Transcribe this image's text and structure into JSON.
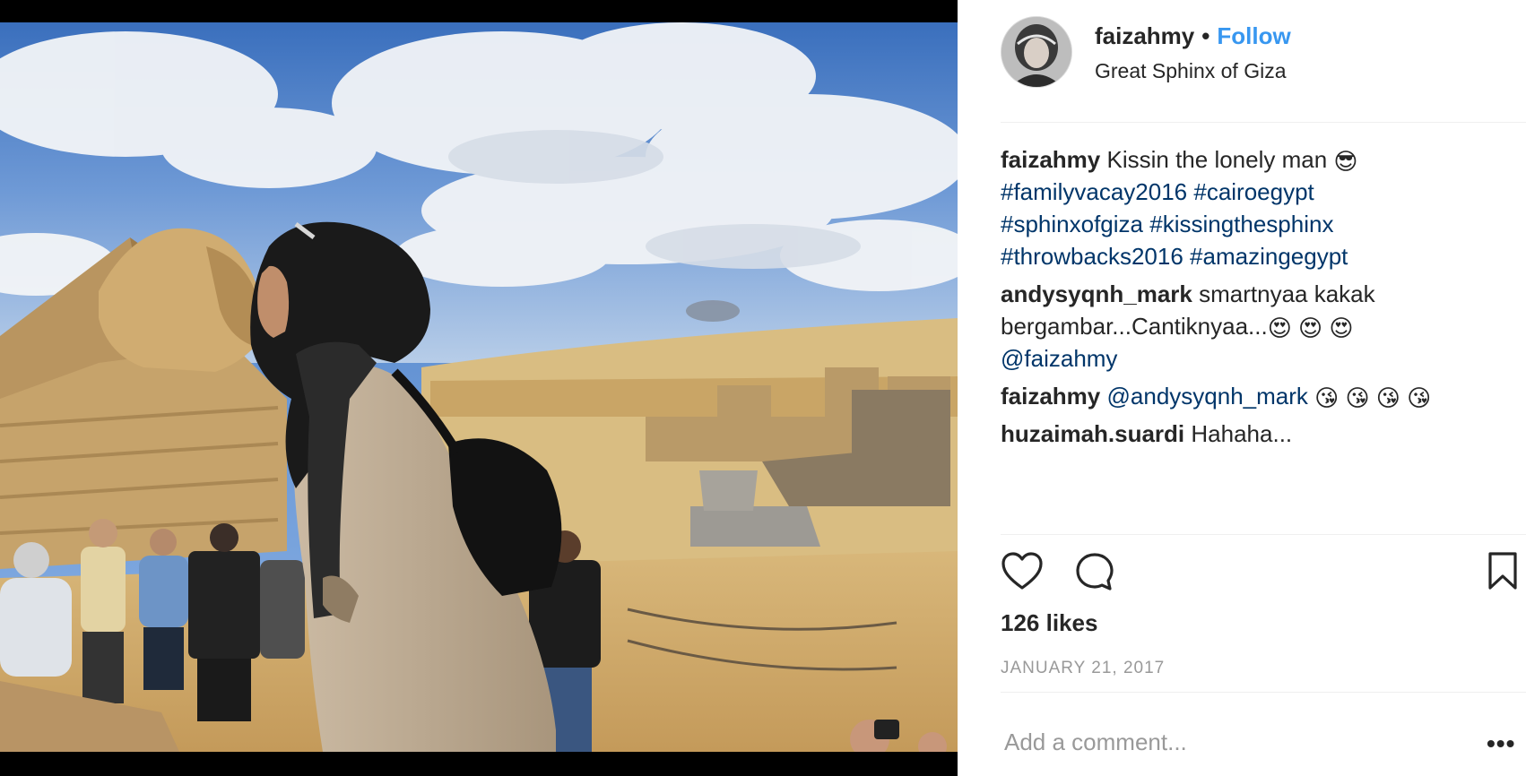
{
  "post": {
    "photo_alt": "",
    "author": {
      "username": "faizahmy",
      "separator": "•",
      "follow_label": "Follow",
      "location": "Great Sphinx of Giza"
    },
    "comments": [
      {
        "username": "faizahmy",
        "text": "Kissin the lonely man",
        "emoji": "😎",
        "hashtags": [
          "#familyvacay2016",
          "#cairoegypt",
          "#sphinxofgiza",
          "#kissingthesphinx",
          "#throwbacks2016",
          "#amazingegypt"
        ]
      },
      {
        "username": "andysyqnh_mark",
        "text": "smartnyaa kakak bergambar...Cantiknyaa...",
        "emoji": "😍 😍 😍",
        "mention": "@faizahmy"
      },
      {
        "username": "faizahmy",
        "mention": "@andysyqnh_mark",
        "emoji": "😘 😘 😘 😘"
      },
      {
        "username": "huzaimah.suardi",
        "text": "Hahaha..."
      }
    ],
    "icons": {
      "like": "heart-icon",
      "comment": "speech-bubble-icon",
      "save": "bookmark-icon",
      "more": "ellipsis-icon"
    },
    "likes_label": "126 likes",
    "date": "January 21, 2017",
    "add_comment_placeholder": "Add a comment...",
    "more_label": "•••"
  },
  "colors": {
    "follow": "#3897f0",
    "hashtag": "#003569",
    "muted": "#999999",
    "text": "#262626"
  }
}
